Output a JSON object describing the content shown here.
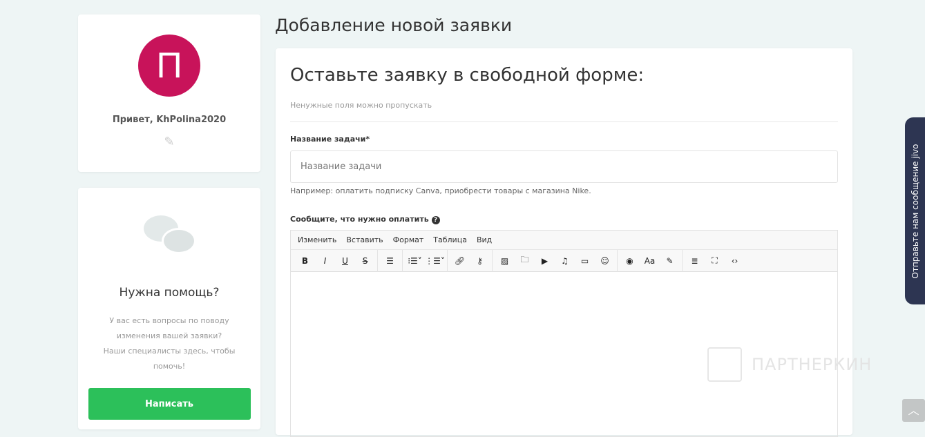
{
  "profile": {
    "avatar_letter": "П",
    "greeting": "Привет, KhPolina2020",
    "avatar_color": "#c8135a"
  },
  "help": {
    "title": "Нужна помощь?",
    "text_lines": [
      "У вас есть вопросы по поводу",
      "изменения вашей заявки?",
      "Наши специалисты здесь, чтобы",
      "помочь!"
    ],
    "button": "Написать"
  },
  "page_title": "Добавление новой заявки",
  "form": {
    "title": "Оставьте заявку в свободной форме:",
    "hint": "Ненужные поля можно пропускать",
    "task_label": "Название задачи*",
    "task_placeholder": "Название задачи",
    "task_example": "Например: оплатить подписку Canva, приобрести товары с магазина Nike.",
    "pay_label": "Сообщите, что нужно оплатить"
  },
  "editor": {
    "menu": [
      "Изменить",
      "Вставить",
      "Формат",
      "Таблица",
      "Вид"
    ]
  },
  "jivo": {
    "label": "Отправьте нам сообщение  jivo"
  },
  "watermark": "ПАРТНЕРКИН"
}
